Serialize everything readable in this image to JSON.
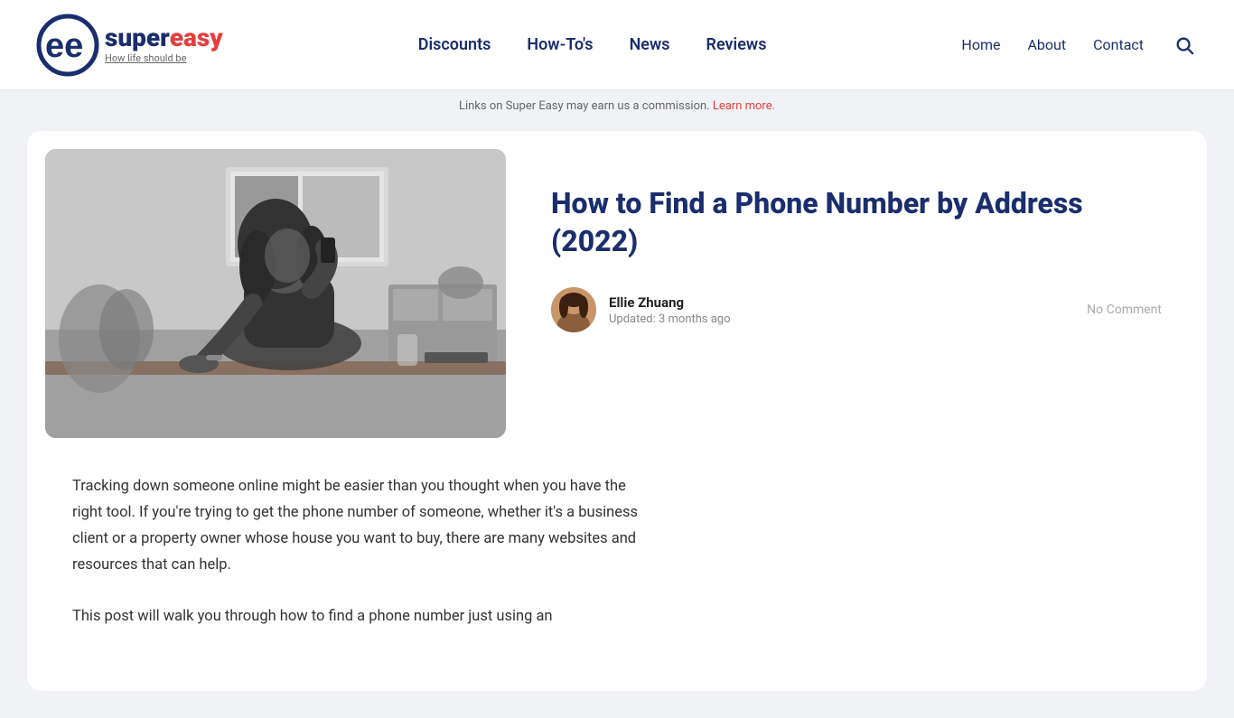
{
  "header": {
    "logo": {
      "text_super": "super",
      "text_easy": "easy",
      "tagline_plain": "How life ",
      "tagline_underline": "should",
      "tagline_end": " be"
    },
    "main_nav": [
      {
        "label": "Discounts",
        "href": "#"
      },
      {
        "label": "How-To's",
        "href": "#"
      },
      {
        "label": "News",
        "href": "#"
      },
      {
        "label": "Reviews",
        "href": "#"
      }
    ],
    "secondary_nav": [
      {
        "label": "Home",
        "href": "#"
      },
      {
        "label": "About",
        "href": "#"
      },
      {
        "label": "Contact",
        "href": "#"
      }
    ]
  },
  "commission_bar": {
    "text": "Links on Super Easy may earn us a commission.",
    "link_text": "Learn more."
  },
  "article": {
    "title": "How to Find a Phone Number by Address (2022)",
    "author": {
      "name": "Ellie Zhuang",
      "updated": "Updated: 3 months ago"
    },
    "comment_count": "No Comment",
    "body_paragraphs": [
      "Tracking down someone online might be easier than you thought when you have the right tool. If you're trying to get the phone number of someone, whether it's a business client or a property owner whose house you want to buy, there are many websites and resources that can help.",
      "This post will walk you through how to find a phone number just using an"
    ]
  },
  "icons": {
    "search": "🔍"
  }
}
